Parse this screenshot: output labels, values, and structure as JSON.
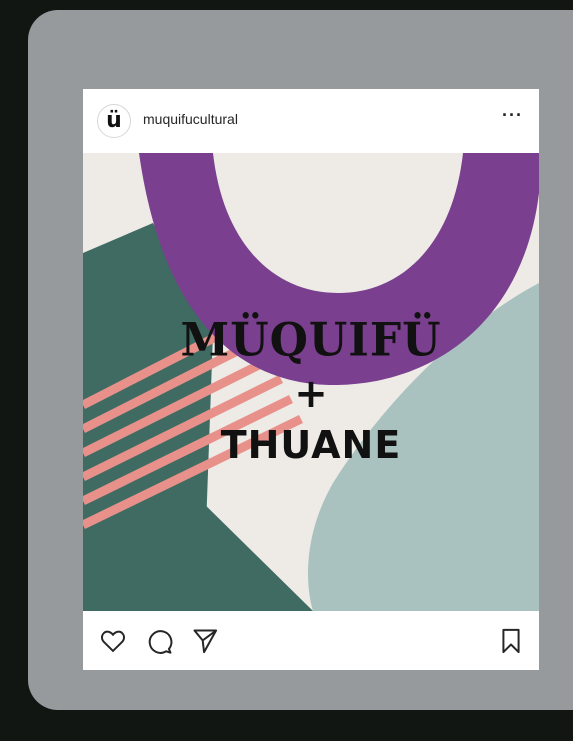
{
  "post": {
    "username": "muquifucultural",
    "avatar_letter": "ü",
    "more_label": "···",
    "image": {
      "headline": "MÜQUIFÜ",
      "joiner": "+",
      "artist": "THUANE"
    },
    "actions": {
      "like_icon": "heart-icon",
      "comment_icon": "comment-icon",
      "share_icon": "paper-plane-icon",
      "save_icon": "bookmark-icon"
    }
  },
  "colors": {
    "background": "#121612",
    "frame": "#969a9c",
    "card": "#ffffff",
    "purple": "#7a3f8e",
    "teal_dark": "#3f6b63",
    "teal_light": "#a9c2bf",
    "salmon": "#e8918a",
    "cream": "#eeeae6"
  }
}
